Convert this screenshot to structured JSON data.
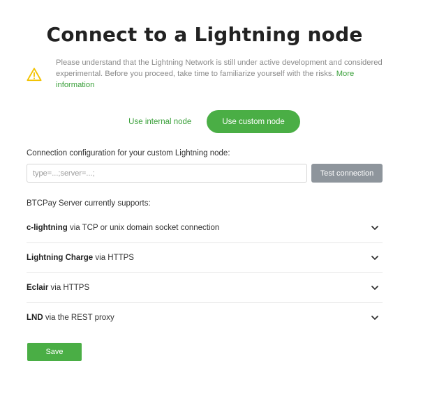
{
  "page": {
    "title": "Connect to a Lightning node"
  },
  "warning": {
    "icon": "warning-triangle-icon",
    "text": "Please understand that the Lightning Network is still under active development and considered experimental. Before you proceed, take time to familiarize yourself with the risks.",
    "link_label": "More information"
  },
  "node_toggle": {
    "internal_label": "Use internal node",
    "custom_label": "Use custom node",
    "selected": "custom"
  },
  "config": {
    "label": "Connection configuration for your custom Lightning node:",
    "value": "",
    "placeholder": "type=...;server=...;",
    "test_button_label": "Test connection"
  },
  "supports": {
    "label": "BTCPay Server currently supports:",
    "items": [
      {
        "name": "c-lightning",
        "description": "via TCP or unix domain socket connection",
        "icon": "chevron-down-icon"
      },
      {
        "name": "Lightning Charge",
        "description": "via HTTPS",
        "icon": "chevron-down-icon"
      },
      {
        "name": "Eclair",
        "description": "via HTTPS",
        "icon": "chevron-down-icon"
      },
      {
        "name": "LND",
        "description": "via the REST proxy",
        "icon": "chevron-down-icon"
      }
    ]
  },
  "actions": {
    "save_label": "Save"
  },
  "colors": {
    "accent": "#4aae45",
    "link": "#3aa03a",
    "warning": "#f2c200",
    "test_button": "#8e959c"
  }
}
